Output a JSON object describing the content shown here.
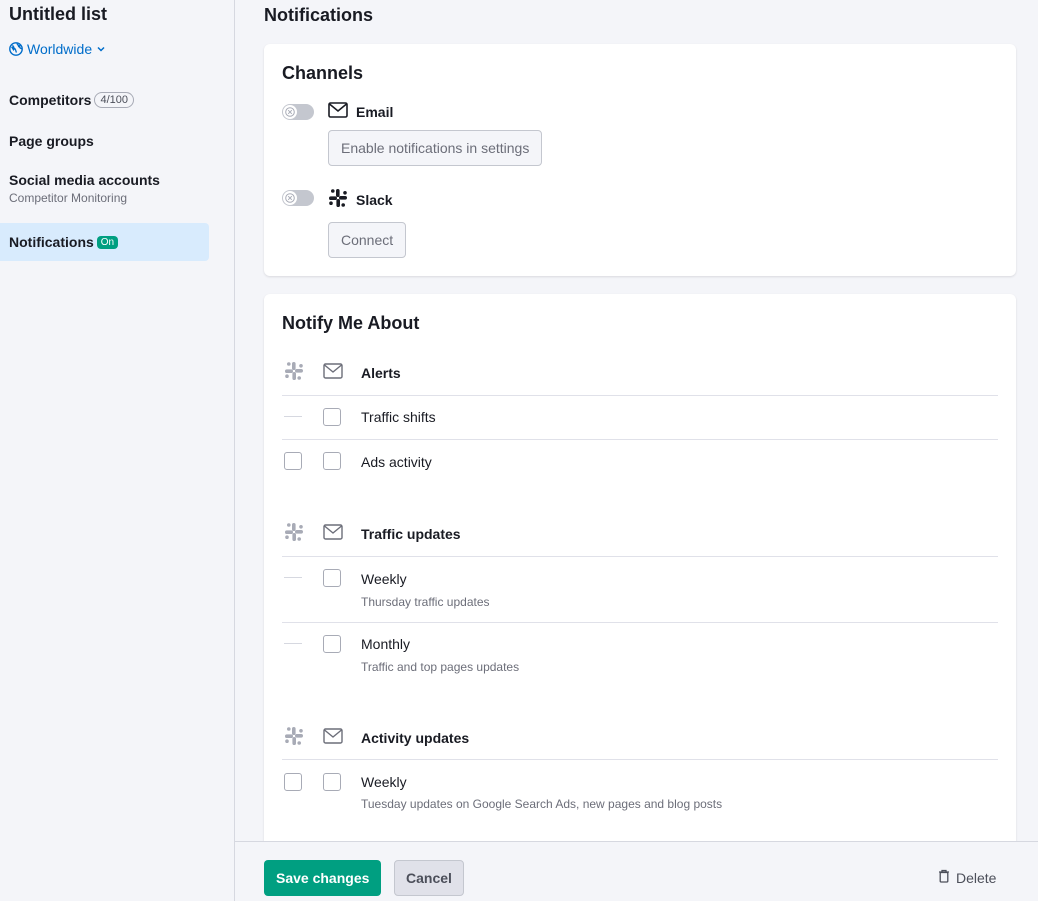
{
  "sidebar": {
    "list_title": "Untitled list",
    "region": "Worldwide",
    "items": [
      {
        "label": "Competitors",
        "badge": "4/100"
      },
      {
        "label": "Page groups"
      },
      {
        "label": "Social media accounts",
        "sub": "Competitor Monitoring"
      },
      {
        "label": "Notifications",
        "badge": "On",
        "active": true
      }
    ]
  },
  "main": {
    "title": "Notifications",
    "channels": {
      "title": "Channels",
      "email": {
        "label": "Email",
        "button": "Enable notifications in settings",
        "enabled": false
      },
      "slack": {
        "label": "Slack",
        "button": "Connect",
        "enabled": false
      }
    },
    "notify": {
      "title": "Notify Me About",
      "groups": [
        {
          "label": "Alerts",
          "rows": [
            {
              "label": "Traffic shifts",
              "slack": "unavailable",
              "email": false
            },
            {
              "label": "Ads activity",
              "slack": false,
              "email": false
            }
          ]
        },
        {
          "label": "Traffic updates",
          "rows": [
            {
              "label": "Weekly",
              "sub": "Thursday traffic updates",
              "slack": "unavailable",
              "email": false
            },
            {
              "label": "Monthly",
              "sub": "Traffic and top pages updates",
              "slack": "unavailable",
              "email": false
            }
          ]
        },
        {
          "label": "Activity updates",
          "rows": [
            {
              "label": "Weekly",
              "sub": "Tuesday updates on Google Search Ads, new pages and blog posts",
              "slack": false,
              "email": false
            }
          ]
        }
      ]
    }
  },
  "footer": {
    "save_label": "Save changes",
    "cancel_label": "Cancel",
    "delete_label": "Delete"
  },
  "colors": {
    "accent": "#009f81",
    "link": "#006dca",
    "active_nav": "#d8ebfd"
  },
  "icons": [
    "globe-icon",
    "chevron-down-icon",
    "mail-icon",
    "slack-icon",
    "trash-icon",
    "toggle-off-icon"
  ]
}
